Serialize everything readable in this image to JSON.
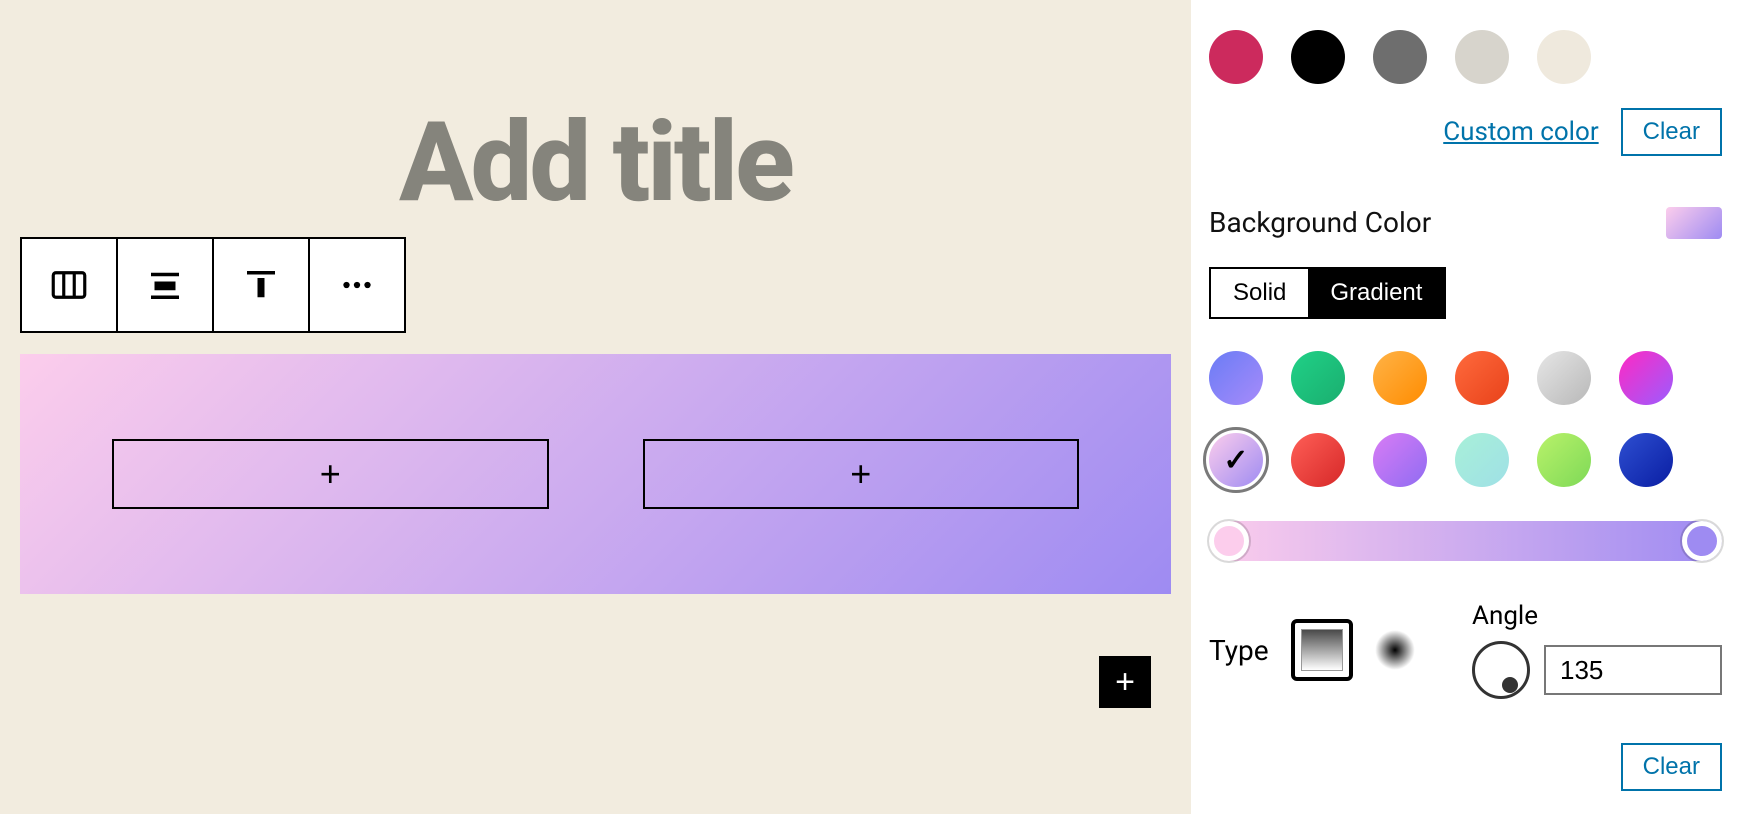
{
  "editor": {
    "title_placeholder": "Add title",
    "toolbar": {
      "columns_tooltip": "Columns",
      "align_tooltip": "Change alignment",
      "valign_tooltip": "Change vertical alignment",
      "more_tooltip": "More options"
    },
    "slot_add_symbol": "+",
    "fab_add_symbol": "+"
  },
  "sidebar": {
    "text_color": {
      "swatches": [
        "#cc2a5d",
        "#000000",
        "#6e6e6e",
        "#d7d4cc",
        "#efe9dd"
      ],
      "custom_color_label": "Custom color",
      "clear_label": "Clear"
    },
    "background": {
      "label": "Background Color",
      "modes": {
        "solid": "Solid",
        "gradient": "Gradient",
        "active": "gradient"
      },
      "presets": [
        {
          "css": "linear-gradient(135deg,#6a7cf5 0%,#a78bfa 100%)",
          "selected": false
        },
        {
          "css": "linear-gradient(135deg,#20d187 0%,#1aae6f 100%)",
          "selected": false
        },
        {
          "css": "linear-gradient(135deg,#ffb347 0%,#ff8c00 100%)",
          "selected": false
        },
        {
          "css": "linear-gradient(135deg,#ff6a3d 0%,#e8421a 100%)",
          "selected": false
        },
        {
          "css": "linear-gradient(135deg,#e6e6e6 0%,#b8b8b8 100%)",
          "selected": false
        },
        {
          "css": "linear-gradient(135deg,#ff29c3 0%,#9b5cff 100%)",
          "selected": false
        },
        {
          "css": "linear-gradient(135deg,#fccdec 0%,#9e8bf2 100%)",
          "selected": true
        },
        {
          "css": "linear-gradient(135deg,#ff5f57 0%,#d62828 100%)",
          "selected": false
        },
        {
          "css": "linear-gradient(135deg,#d97cf5 0%,#8f6cf2 100%)",
          "selected": false
        },
        {
          "css": "linear-gradient(135deg,#a8f0d8 0%,#9fe0e6 100%)",
          "selected": false
        },
        {
          "css": "linear-gradient(135deg,#b9f26a 0%,#7ed957 100%)",
          "selected": false
        },
        {
          "css": "linear-gradient(135deg,#2e4fd1 0%,#0a1ea3 100%)",
          "selected": false
        }
      ],
      "stops": [
        "#fccdec",
        "#9e8bf2"
      ],
      "type_label": "Type",
      "type": "linear",
      "angle_label": "Angle",
      "angle_value": "135",
      "clear_label": "Clear"
    }
  }
}
